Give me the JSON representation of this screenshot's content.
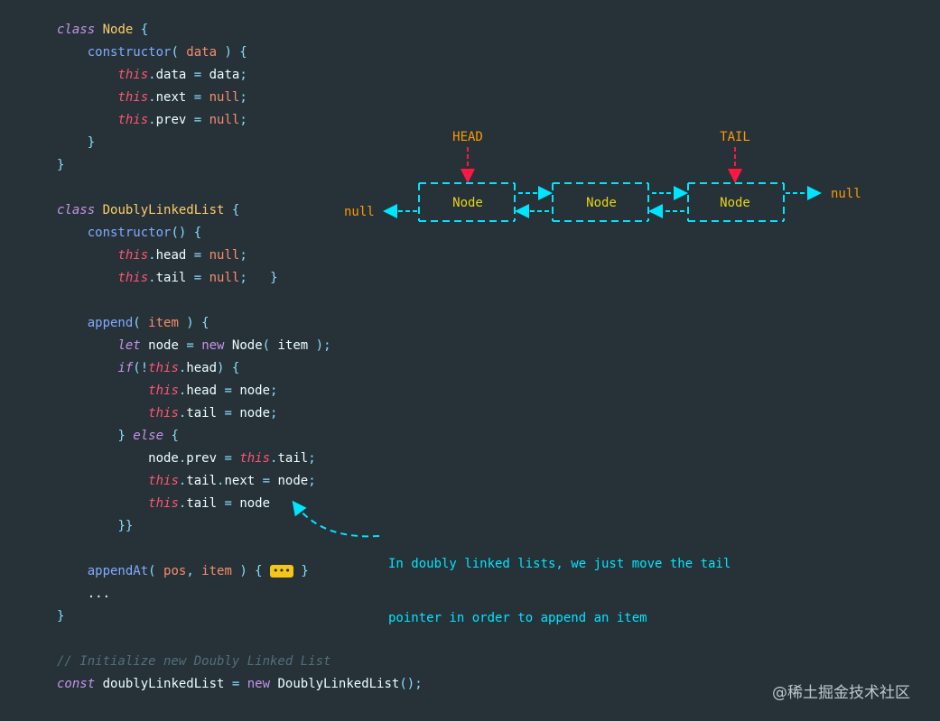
{
  "code_lines": [
    [
      [
        "kw-class",
        "class"
      ],
      [
        "plain",
        " "
      ],
      [
        "cls",
        "Node"
      ],
      [
        "punc",
        " {"
      ]
    ],
    [
      [
        "plain",
        "    "
      ],
      [
        "fn",
        "constructor"
      ],
      [
        "punc",
        "( "
      ],
      [
        "param",
        "data"
      ],
      [
        "punc",
        " ) {"
      ]
    ],
    [
      [
        "plain",
        "        "
      ],
      [
        "this",
        "this"
      ],
      [
        "punc",
        "."
      ],
      [
        "prop",
        "data"
      ],
      [
        "op",
        " = "
      ],
      [
        "plain",
        "data"
      ],
      [
        "punc",
        ";"
      ]
    ],
    [
      [
        "plain",
        "        "
      ],
      [
        "this",
        "this"
      ],
      [
        "punc",
        "."
      ],
      [
        "prop",
        "next"
      ],
      [
        "op",
        " = "
      ],
      [
        "lit",
        "null"
      ],
      [
        "punc",
        ";"
      ]
    ],
    [
      [
        "plain",
        "        "
      ],
      [
        "this",
        "this"
      ],
      [
        "punc",
        "."
      ],
      [
        "prop",
        "prev"
      ],
      [
        "op",
        " = "
      ],
      [
        "lit",
        "null"
      ],
      [
        "punc",
        ";"
      ]
    ],
    [
      [
        "plain",
        "    "
      ],
      [
        "punc",
        "}"
      ]
    ],
    [
      [
        "punc",
        "}"
      ]
    ],
    [],
    [
      [
        "kw-class",
        "class"
      ],
      [
        "plain",
        " "
      ],
      [
        "cls",
        "DoublyLinkedList"
      ],
      [
        "punc",
        " {"
      ]
    ],
    [
      [
        "plain",
        "    "
      ],
      [
        "fn",
        "constructor"
      ],
      [
        "punc",
        "() {"
      ]
    ],
    [
      [
        "plain",
        "        "
      ],
      [
        "this",
        "this"
      ],
      [
        "punc",
        "."
      ],
      [
        "prop",
        "head"
      ],
      [
        "op",
        " = "
      ],
      [
        "lit",
        "null"
      ],
      [
        "punc",
        ";"
      ]
    ],
    [
      [
        "plain",
        "        "
      ],
      [
        "this",
        "this"
      ],
      [
        "punc",
        "."
      ],
      [
        "prop",
        "tail"
      ],
      [
        "op",
        " = "
      ],
      [
        "lit",
        "null"
      ],
      [
        "punc",
        ";"
      ],
      [
        "plain",
        "   "
      ],
      [
        "punc",
        "}"
      ]
    ],
    [],
    [
      [
        "plain",
        "    "
      ],
      [
        "fn",
        "append"
      ],
      [
        "punc",
        "( "
      ],
      [
        "param",
        "item"
      ],
      [
        "punc",
        " ) {"
      ]
    ],
    [
      [
        "plain",
        "        "
      ],
      [
        "kw",
        "let"
      ],
      [
        "plain",
        " node"
      ],
      [
        "op",
        " = "
      ],
      [
        "newkw",
        "new"
      ],
      [
        "plain",
        " Node"
      ],
      [
        "punc",
        "( "
      ],
      [
        "plain",
        "item"
      ],
      [
        "punc",
        " );"
      ]
    ],
    [
      [
        "plain",
        "        "
      ],
      [
        "kw",
        "if"
      ],
      [
        "punc",
        "(!"
      ],
      [
        "this",
        "this"
      ],
      [
        "punc",
        "."
      ],
      [
        "prop",
        "head"
      ],
      [
        "punc",
        ") {"
      ]
    ],
    [
      [
        "plain",
        "            "
      ],
      [
        "this",
        "this"
      ],
      [
        "punc",
        "."
      ],
      [
        "prop",
        "head"
      ],
      [
        "op",
        " = "
      ],
      [
        "plain",
        "node"
      ],
      [
        "punc",
        ";"
      ]
    ],
    [
      [
        "plain",
        "            "
      ],
      [
        "this",
        "this"
      ],
      [
        "punc",
        "."
      ],
      [
        "prop",
        "tail"
      ],
      [
        "op",
        " = "
      ],
      [
        "plain",
        "node"
      ],
      [
        "punc",
        ";"
      ]
    ],
    [
      [
        "plain",
        "        "
      ],
      [
        "punc",
        "} "
      ],
      [
        "kw",
        "else"
      ],
      [
        "punc",
        " {"
      ]
    ],
    [
      [
        "plain",
        "            node"
      ],
      [
        "punc",
        "."
      ],
      [
        "prop",
        "prev"
      ],
      [
        "op",
        " = "
      ],
      [
        "this",
        "this"
      ],
      [
        "punc",
        "."
      ],
      [
        "prop",
        "tail"
      ],
      [
        "punc",
        ";"
      ]
    ],
    [
      [
        "plain",
        "            "
      ],
      [
        "this",
        "this"
      ],
      [
        "punc",
        "."
      ],
      [
        "prop",
        "tail"
      ],
      [
        "punc",
        "."
      ],
      [
        "prop",
        "next"
      ],
      [
        "op",
        " = "
      ],
      [
        "plain",
        "node"
      ],
      [
        "punc",
        ";"
      ]
    ],
    [
      [
        "plain",
        "            "
      ],
      [
        "this",
        "this"
      ],
      [
        "punc",
        "."
      ],
      [
        "prop",
        "tail"
      ],
      [
        "op",
        " = "
      ],
      [
        "plain",
        "node"
      ]
    ],
    [
      [
        "plain",
        "        "
      ],
      [
        "punc",
        "}}"
      ]
    ],
    [],
    [
      [
        "plain",
        "    "
      ],
      [
        "fn",
        "appendAt"
      ],
      [
        "punc",
        "( "
      ],
      [
        "param",
        "pos"
      ],
      [
        "punc",
        ", "
      ],
      [
        "param",
        "item"
      ],
      [
        "punc",
        " ) { "
      ],
      [
        "fold",
        "•••"
      ],
      [
        "punc",
        " }"
      ]
    ],
    [
      [
        "plain",
        "    ..."
      ]
    ],
    [
      [
        "punc",
        "}"
      ]
    ],
    [],
    [
      [
        "cmt",
        "// Initialize new Doubly Linked List"
      ]
    ],
    [
      [
        "constkw",
        "const"
      ],
      [
        "plain",
        " doublyLinkedList"
      ],
      [
        "op",
        " = "
      ],
      [
        "newkw",
        "new"
      ],
      [
        "plain",
        " DoublyLinkedList"
      ],
      [
        "punc",
        "();"
      ]
    ]
  ],
  "diagram": {
    "head_label": "HEAD",
    "tail_label": "TAIL",
    "nodes": [
      "Node",
      "Node",
      "Node"
    ],
    "left_null": "null",
    "right_null": "null",
    "colors": {
      "accent": "#00e5ff",
      "pointer": "#ff1744",
      "label": "#ff9800",
      "node_text": "#e6d31a"
    }
  },
  "note": {
    "line1": "In doubly linked lists, we just move the tail",
    "line2": "pointer in order to append an item"
  },
  "watermark": "@稀土掘金技术社区"
}
